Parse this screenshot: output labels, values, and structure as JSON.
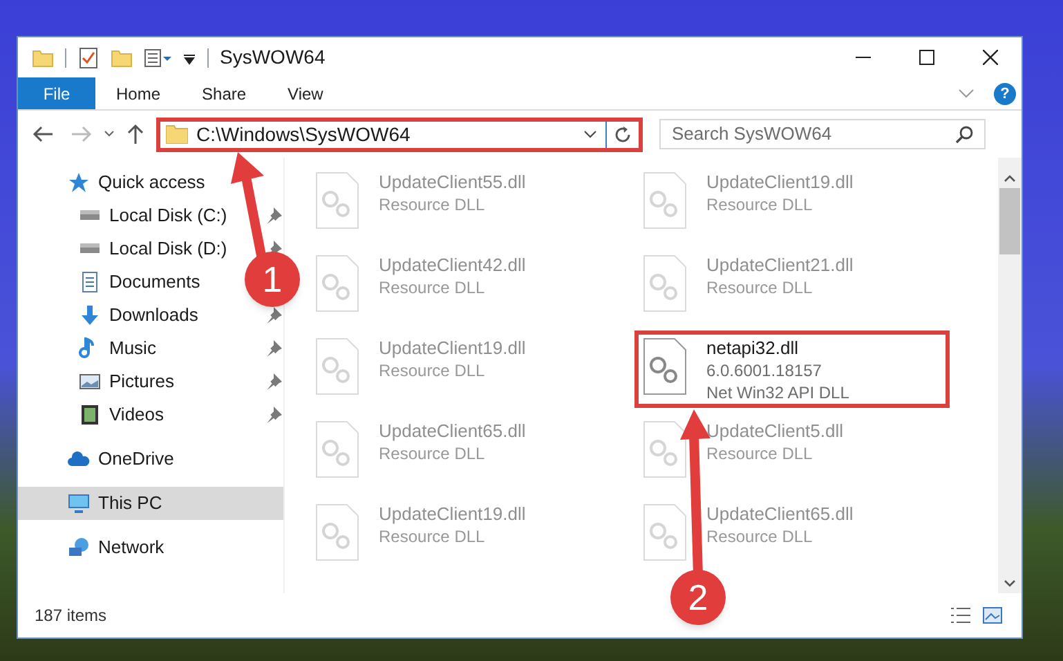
{
  "window": {
    "title": "SysWOW64"
  },
  "ribbon": {
    "tabs": [
      {
        "label": "File",
        "selected": true
      },
      {
        "label": "Home",
        "selected": false
      },
      {
        "label": "Share",
        "selected": false
      },
      {
        "label": "View",
        "selected": false
      }
    ]
  },
  "address": {
    "path": "C:\\Windows\\SysWOW64",
    "highlighted": true
  },
  "search": {
    "placeholder": "Search SysWOW64"
  },
  "help": {
    "label": "?"
  },
  "sidebar": {
    "items": [
      {
        "label": "Quick access",
        "kind": "star",
        "selected": false,
        "children": [
          {
            "label": "Local Disk (C:)",
            "kind": "drive",
            "pinned": true,
            "selected": false
          },
          {
            "label": "Local Disk (D:)",
            "kind": "drive",
            "pinned": true,
            "selected": false
          },
          {
            "label": "Documents",
            "kind": "documents",
            "selected": false
          },
          {
            "label": "Downloads",
            "kind": "downloads",
            "pinned": true,
            "selected": false
          },
          {
            "label": "Music",
            "kind": "music",
            "pinned": true,
            "selected": false
          },
          {
            "label": "Pictures",
            "kind": "pictures",
            "pinned": true,
            "selected": false
          },
          {
            "label": "Videos",
            "kind": "videos",
            "pinned": true,
            "selected": false
          }
        ]
      },
      {
        "label": "OneDrive",
        "kind": "cloud",
        "selected": false
      },
      {
        "label": "This PC",
        "kind": "computer",
        "selected": true
      },
      {
        "label": "Network",
        "kind": "network",
        "selected": false
      }
    ]
  },
  "files": [
    {
      "name": "UpdateClient55.dll",
      "details": [
        "Resource DLL"
      ],
      "faded": true,
      "highlighted": false
    },
    {
      "name": "UpdateClient19.dll",
      "details": [
        "Resource DLL"
      ],
      "faded": true,
      "highlighted": false
    },
    {
      "name": "UpdateClient42.dll",
      "details": [
        "Resource DLL"
      ],
      "faded": true,
      "highlighted": false
    },
    {
      "name": "UpdateClient21.dll",
      "details": [
        "Resource DLL"
      ],
      "faded": true,
      "highlighted": false
    },
    {
      "name": "UpdateClient19.dll",
      "details": [
        "Resource DLL"
      ],
      "faded": true,
      "highlighted": false
    },
    {
      "name": "netapi32.dll",
      "details": [
        "6.0.6001.18157",
        "Net Win32 API DLL"
      ],
      "faded": false,
      "highlighted": true
    },
    {
      "name": "UpdateClient65.dll",
      "details": [
        "Resource DLL"
      ],
      "faded": true,
      "highlighted": false
    },
    {
      "name": "UpdateClient5.dll",
      "details": [
        "Resource DLL"
      ],
      "faded": true,
      "highlighted": false
    },
    {
      "name": "UpdateClient19.dll",
      "details": [
        "Resource DLL"
      ],
      "faded": true,
      "highlighted": false
    },
    {
      "name": "UpdateClient65.dll",
      "details": [
        "Resource DLL"
      ],
      "faded": true,
      "highlighted": false
    }
  ],
  "status_bar": {
    "item_count": "187 items"
  },
  "callouts": [
    {
      "label": "1"
    },
    {
      "label": "2"
    }
  ]
}
